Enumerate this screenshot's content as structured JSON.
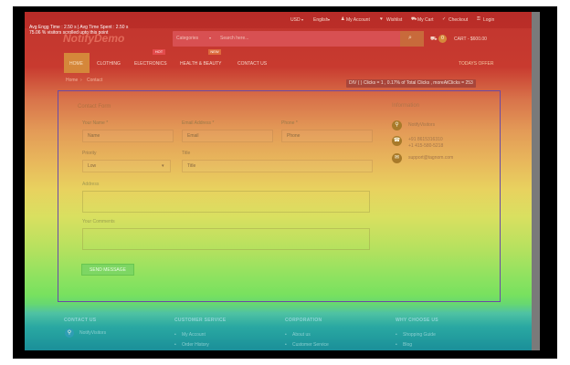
{
  "top": {
    "currency": "USD",
    "language": "English",
    "links": [
      "My Account",
      "Wishlist",
      "My Cart",
      "Checkout",
      "Login"
    ]
  },
  "heatmap": {
    "info_line1": "Avg Engg Time : 2.50 s | Avg Time Spent : 2.50 s",
    "info_line2": "75.06 % visitors scrolled upto this point",
    "element_tag": "DIV ( ) Clicks = 1 , 0.17% of Total Clicks , moreAtClicks = 253"
  },
  "header": {
    "logo": "NotifyDemo",
    "categories": "Categories",
    "search_placeholder": "Search here...",
    "cart_count": "0",
    "cart_label": "CART - $600.00"
  },
  "nav": {
    "items": [
      "HOME",
      "CLOTHING",
      "ELECTRONICS",
      "HEALTH & BEAUTY",
      "CONTACT US"
    ],
    "badge_electronics": "HOT",
    "badge_health": "NEW",
    "offer": "TODAYS OFFER"
  },
  "breadcrumb": {
    "home": "Home",
    "current": "Contact"
  },
  "contact_form": {
    "title": "Contact Form",
    "name_label": "Your Name *",
    "name_value": "Name",
    "email_label": "Email Address *",
    "email_value": "Email",
    "phone_label": "Phone *",
    "phone_value": "Phone",
    "priority_label": "Priority",
    "priority_value": "Low",
    "title_label": "Title",
    "title_value": "Title",
    "address_label": "Address",
    "comments_label": "Your Comments",
    "send_label": "SEND MESSAGE"
  },
  "information": {
    "title": "Information",
    "company": "NotifyVisitors",
    "phone1": "+91 8615316310",
    "phone2": "+1 415-580-5218",
    "email": "support@tagnom.com"
  },
  "footer": {
    "col1": "CONTACT US",
    "col2": "CUSTOMER SERVICE",
    "col3": "CORPORATION",
    "col4": "WHY CHOOSE US",
    "col1_item": "NotifyVisitors",
    "col2_item1": "My Account",
    "col2_item2": "Order History",
    "col3_item1": "About us",
    "col3_item2": "Customer Service",
    "col4_item1": "Shopping Guide",
    "col4_item2": "Blog"
  }
}
